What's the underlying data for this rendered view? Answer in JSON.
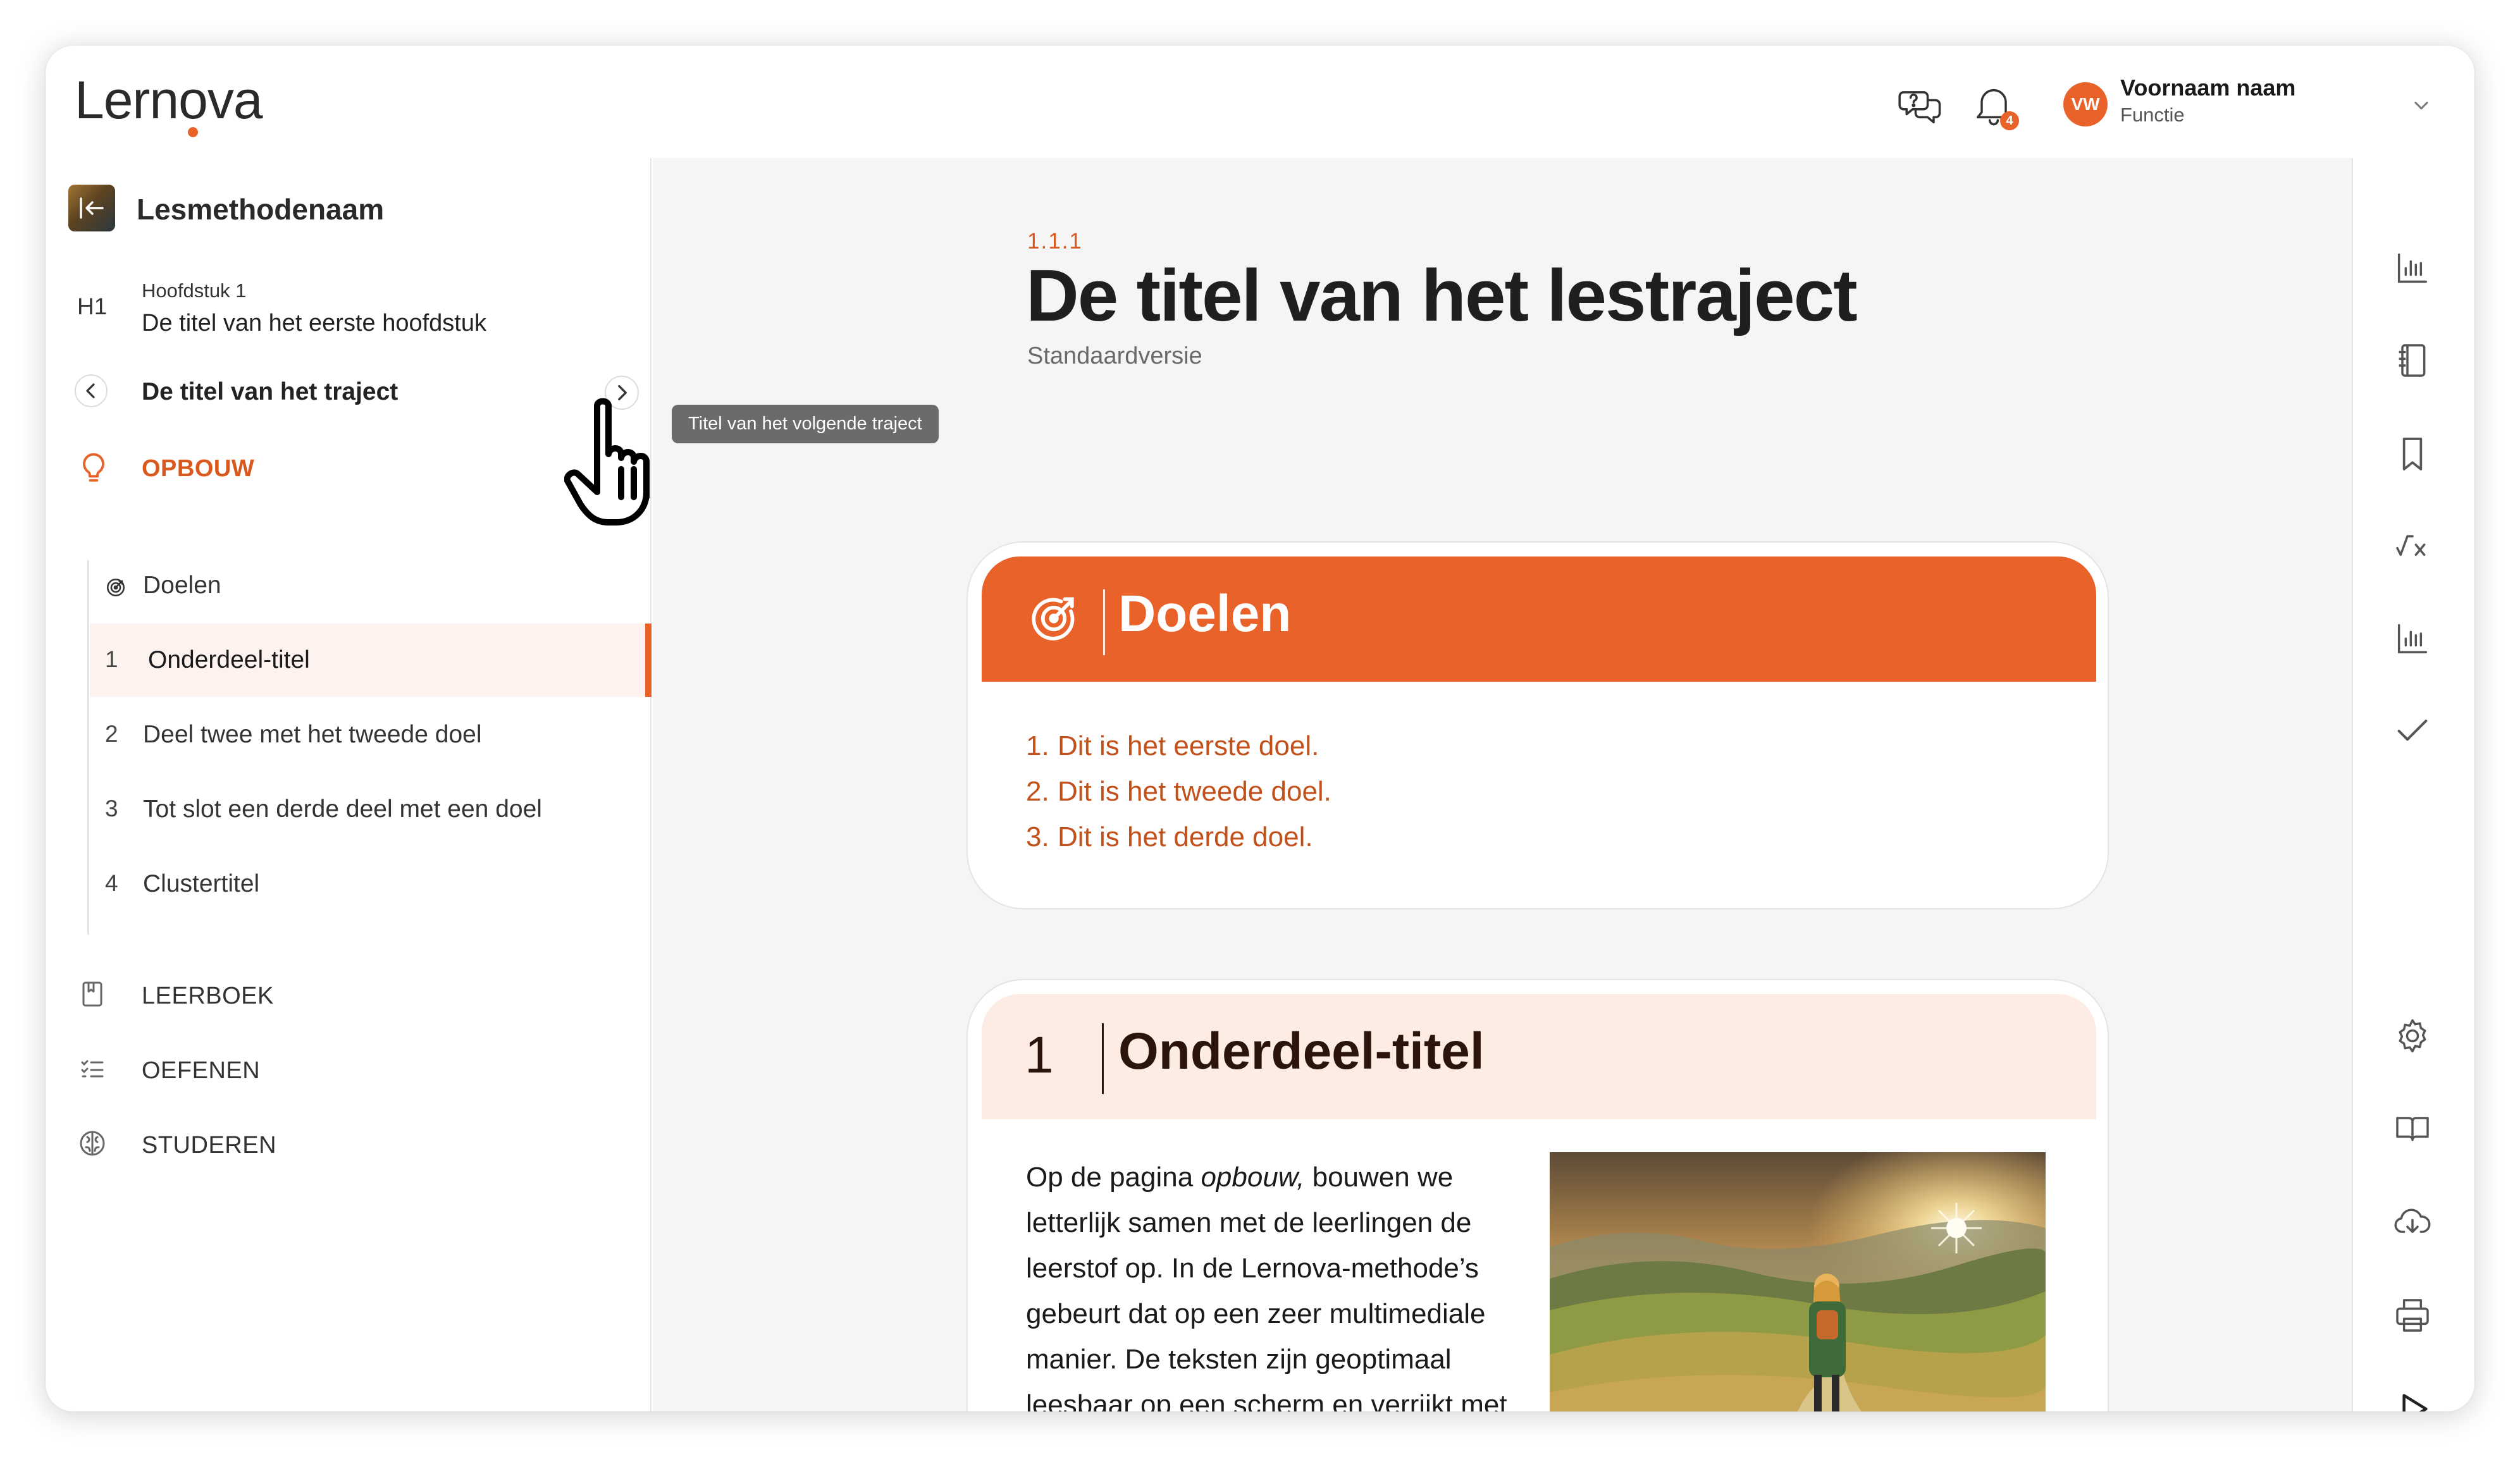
{
  "header": {
    "logo": "Lernova",
    "notification_count": "4",
    "user": {
      "initials": "VW",
      "name": "Voornaam naam",
      "role": "Functie"
    }
  },
  "sidebar": {
    "method_name": "Lesmethodenaam",
    "chapter": {
      "code": "H1",
      "label": "Hoofdstuk 1",
      "title": "De titel van het eerste hoofdstuk"
    },
    "trajectory_title": "De titel van het traject",
    "next_tooltip": "Titel van het volgende traject",
    "section_label": "OPBOUW",
    "items": [
      {
        "num": "",
        "label": "Doelen"
      },
      {
        "num": "1",
        "label": "Onderdeel-titel"
      },
      {
        "num": "2",
        "label": "Deel twee met het tweede doel"
      },
      {
        "num": "3",
        "label": "Tot slot een derde deel met een doel"
      },
      {
        "num": "4",
        "label": "Clustertitel"
      }
    ],
    "active_index": 1,
    "sections": [
      {
        "label": "LEERBOEK",
        "icon": "book-icon"
      },
      {
        "label": "OEFENEN",
        "icon": "checklist-icon"
      },
      {
        "label": "STUDEREN",
        "icon": "brain-icon"
      }
    ]
  },
  "main": {
    "section_number": "1.1.1",
    "title": "De titel van het lestraject",
    "subtitle": "Standaardversie",
    "goals_card": {
      "heading": "Doelen",
      "goals": [
        {
          "num": "1.",
          "text": "Dit is het eerste doel."
        },
        {
          "num": "2.",
          "text": "Dit is het tweede doel."
        },
        {
          "num": "3.",
          "text": "Dit is het derde doel."
        }
      ]
    },
    "part_card": {
      "number": "1",
      "heading": "Onderdeel-titel",
      "body_before": "Op de pagina ",
      "body_emph": "opbouw,",
      "body_after": " bouwen we letterlijk samen met de leerlingen de leerstof op. In de Lernova-methode’s gebeurt dat op een zeer multimediale manier. De teksten zijn geoptimaal leesbaar op een scherm en verrijkt met afbeeldingen. Deze structuur helpt"
    }
  },
  "rail": {
    "icons": [
      "bar-chart-icon",
      "notebook-icon",
      "bookmark-icon",
      "formula-icon",
      "bar-chart-icon",
      "check-icon",
      "settings-icon",
      "open-book-icon",
      "cloud-download-icon",
      "print-icon",
      "play-icon"
    ]
  },
  "colors": {
    "accent": "#e9622a",
    "accent_text": "#c2501a",
    "accent_soft": "#fcece3",
    "dark_heading": "#2b150a"
  }
}
